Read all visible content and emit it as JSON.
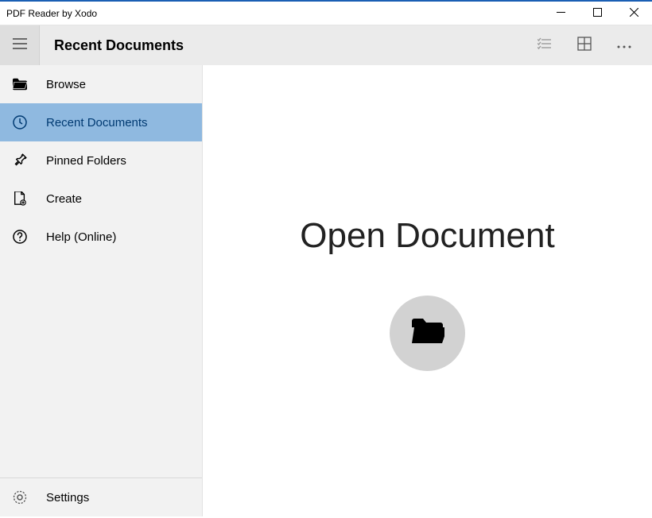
{
  "window": {
    "title": "PDF Reader by Xodo"
  },
  "toolbar": {
    "page_title": "Recent Documents"
  },
  "sidebar": {
    "items": [
      {
        "label": "Browse"
      },
      {
        "label": "Recent Documents"
      },
      {
        "label": "Pinned Folders"
      },
      {
        "label": "Create"
      },
      {
        "label": "Help (Online)"
      }
    ],
    "footer": {
      "label": "Settings"
    }
  },
  "main": {
    "heading": "Open Document"
  }
}
